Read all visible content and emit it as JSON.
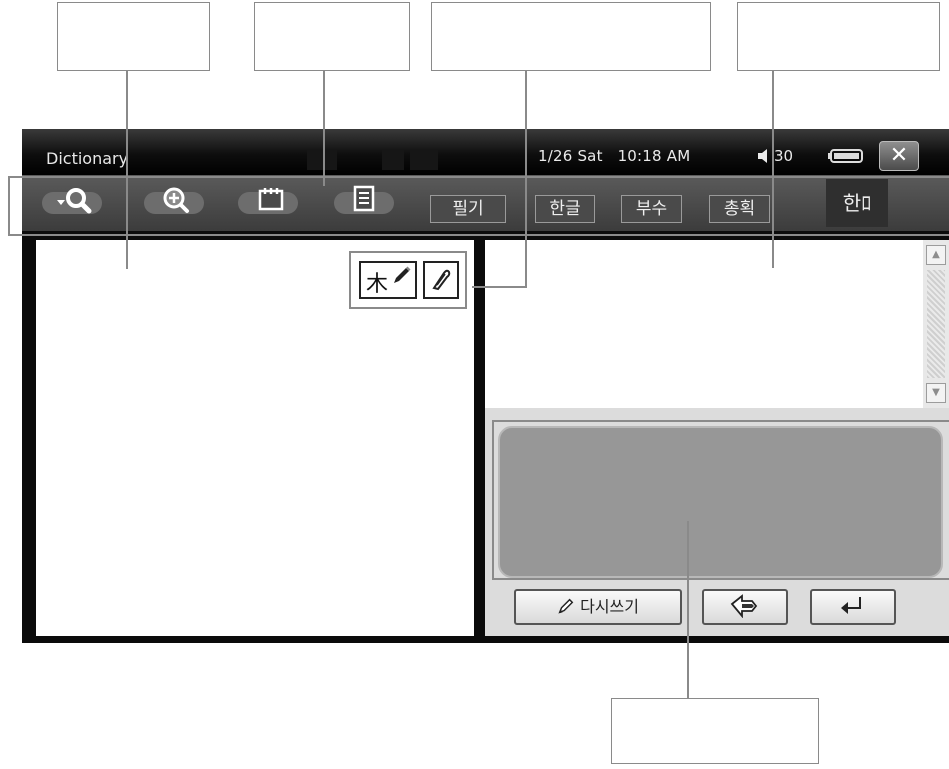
{
  "window": {
    "title": "Dictionary"
  },
  "status": {
    "date": "1/26 Sat",
    "time": "10:18 AM",
    "volume": "30",
    "close_glyph": "✕"
  },
  "toolbar": {
    "tools": [
      {
        "icon": "search-dropdown-icon"
      },
      {
        "icon": "zoom-search-icon"
      },
      {
        "icon": "notepad-icon"
      },
      {
        "icon": "document-list-icon"
      }
    ],
    "modes": [
      "필기",
      "한글",
      "부수",
      "총획"
    ],
    "language_toggle": "한ﾛ"
  },
  "handwriting_panel": {
    "buttons": [
      {
        "label": "木",
        "icon": "hanja-pen-icon"
      },
      {
        "icon": "pen-tool-icon"
      }
    ]
  },
  "writing_pad": {
    "rewrite_label": "다시쓰기",
    "back_icon": "undo-arrow-icon",
    "enter_icon": "enter-icon"
  },
  "scrollbar": {
    "up": "▲",
    "down": "▼"
  },
  "colors": {
    "screen_bg": "#0b0b0b",
    "toolbar_bg": "#4a4a4a",
    "pad_bg": "#979797",
    "callout_border": "#8a8a8a"
  }
}
